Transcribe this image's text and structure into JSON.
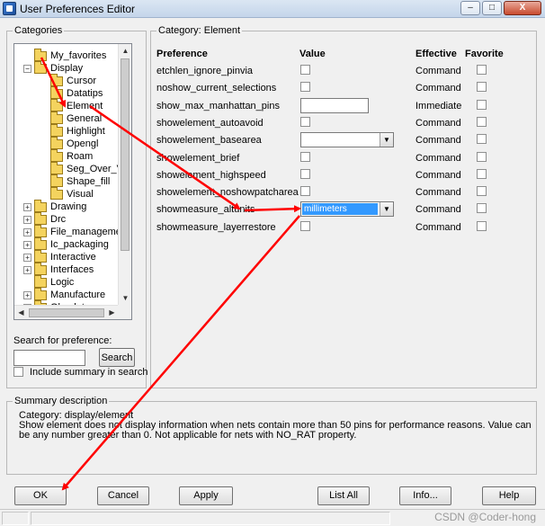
{
  "window": {
    "title": "User Preferences Editor",
    "controls": {
      "minimize": "–",
      "maximize": "□",
      "close": "X"
    }
  },
  "categories": {
    "legend": "Categories",
    "tree": [
      {
        "label": "My_favorites",
        "depth": 0,
        "expander": ""
      },
      {
        "label": "Display",
        "depth": 0,
        "expander": "−"
      },
      {
        "label": "Cursor",
        "depth": 1,
        "expander": ""
      },
      {
        "label": "Datatips",
        "depth": 1,
        "expander": ""
      },
      {
        "label": "Element",
        "depth": 1,
        "expander": ""
      },
      {
        "label": "General",
        "depth": 1,
        "expander": ""
      },
      {
        "label": "Highlight",
        "depth": 1,
        "expander": ""
      },
      {
        "label": "Opengl",
        "depth": 1,
        "expander": ""
      },
      {
        "label": "Roam",
        "depth": 1,
        "expander": ""
      },
      {
        "label": "Seg_Over_Voi",
        "depth": 1,
        "expander": ""
      },
      {
        "label": "Shape_fill",
        "depth": 1,
        "expander": ""
      },
      {
        "label": "Visual",
        "depth": 1,
        "expander": ""
      },
      {
        "label": "Drawing",
        "depth": 0,
        "expander": "+"
      },
      {
        "label": "Drc",
        "depth": 0,
        "expander": "+"
      },
      {
        "label": "File_management",
        "depth": 0,
        "expander": "+"
      },
      {
        "label": "Ic_packaging",
        "depth": 0,
        "expander": "+"
      },
      {
        "label": "Interactive",
        "depth": 0,
        "expander": "+"
      },
      {
        "label": "Interfaces",
        "depth": 0,
        "expander": "+"
      },
      {
        "label": "Logic",
        "depth": 0,
        "expander": ""
      },
      {
        "label": "Manufacture",
        "depth": 0,
        "expander": "+"
      },
      {
        "label": "Obsolete",
        "depth": 0,
        "expander": "+"
      }
    ],
    "search_label": "Search for preference:",
    "search_value": "",
    "search_button": "Search",
    "include_summary_label": "Include summary in search"
  },
  "preferences": {
    "legend": "Category:  Element",
    "headers": {
      "preference": "Preference",
      "value": "Value",
      "effective": "Effective",
      "favorite": "Favorite"
    },
    "rows": [
      {
        "name": "etchlen_ignore_pinvia",
        "control": "checkbox",
        "value": "",
        "effective": "Command"
      },
      {
        "name": "noshow_current_selections",
        "control": "checkbox",
        "value": "",
        "effective": "Command"
      },
      {
        "name": "show_max_manhattan_pins",
        "control": "text",
        "value": "",
        "effective": "Immediate"
      },
      {
        "name": "showelement_autoavoid",
        "control": "checkbox",
        "value": "",
        "effective": "Command"
      },
      {
        "name": "showelement_basearea",
        "control": "select",
        "value": "",
        "effective": "Command"
      },
      {
        "name": "showelement_brief",
        "control": "checkbox",
        "value": "",
        "effective": "Command"
      },
      {
        "name": "showelement_highspeed",
        "control": "checkbox",
        "value": "",
        "effective": "Command"
      },
      {
        "name": "showelement_noshowpatcharea",
        "control": "checkbox",
        "value": "",
        "effective": "Command"
      },
      {
        "name": "showmeasure_altunits",
        "control": "select",
        "value": "millimeters",
        "effective": "Command",
        "selected": true
      },
      {
        "name": "showmeasure_layerrestore",
        "control": "checkbox",
        "value": "",
        "effective": "Command"
      }
    ]
  },
  "summary": {
    "legend": "Summary description",
    "category": "Category: display/element",
    "description": "Show element does not display information when nets contain more than 50 pins for performance reasons. Value can be any number greater than 0. Not applicable for nets with NO_RAT property."
  },
  "buttons": {
    "ok": "OK",
    "cancel": "Cancel",
    "apply": "Apply",
    "list_all": "List All",
    "info": "Info...",
    "help": "Help"
  },
  "status": {
    "watermark": "CSDN @Coder-hong"
  },
  "annotation_color": "#ff0000"
}
